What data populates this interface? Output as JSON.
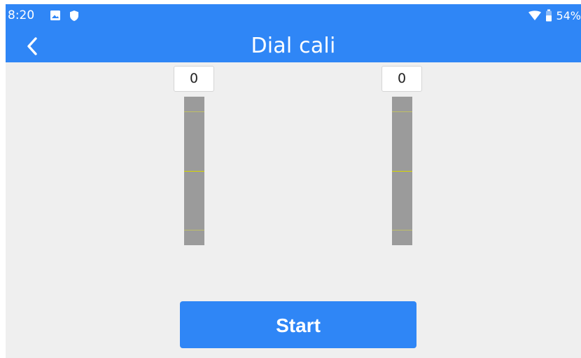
{
  "status_bar": {
    "time": "8:20",
    "battery": "54%",
    "icons": [
      "image-icon",
      "shield-icon",
      "wifi-icon",
      "battery-icon"
    ]
  },
  "header": {
    "title": "Dial cali",
    "back_icon": "back-arrow-icon"
  },
  "dials": [
    {
      "value": "0"
    },
    {
      "value": "0"
    }
  ],
  "actions": {
    "start_label": "Start"
  },
  "colors": {
    "accent": "#2f86f6",
    "background": "#efefef",
    "slider": "#9b9b9b",
    "marker": "#d6d600"
  }
}
